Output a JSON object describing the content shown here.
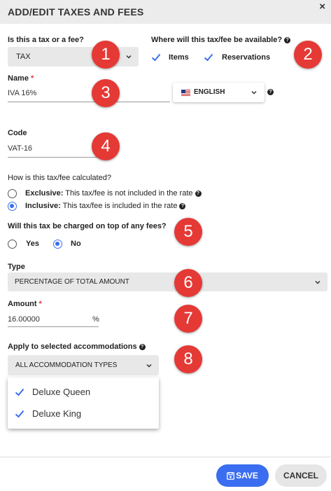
{
  "dialog": {
    "title": "ADD/EDIT TAXES AND FEES",
    "close": "×"
  },
  "tax_or_fee": {
    "label": "Is this a tax or a fee?",
    "value": "TAX"
  },
  "availability": {
    "label": "Where will this tax/fee be available?",
    "options": [
      {
        "label": "Items",
        "checked": true
      },
      {
        "label": "Reservations",
        "checked": true
      }
    ]
  },
  "name": {
    "label": "Name",
    "required": "*",
    "value": "IVA 16%"
  },
  "language": {
    "value": "ENGLISH",
    "icon": "us-flag-icon"
  },
  "code": {
    "label": "Code",
    "value": "VAT-16"
  },
  "calculation": {
    "label": "How is this tax/fee calculated?",
    "options": [
      {
        "title": "Exclusive:",
        "desc": "This tax/fee is not included in the rate",
        "selected": false
      },
      {
        "title": "Inclusive:",
        "desc": "This tax/fee is included in the rate",
        "selected": true
      }
    ]
  },
  "on_top_of_fees": {
    "label": "Will this tax be charged on top of any fees?",
    "options": [
      {
        "label": "Yes",
        "selected": false
      },
      {
        "label": "No",
        "selected": true
      }
    ]
  },
  "type": {
    "label": "Type",
    "value": "PERCENTAGE OF TOTAL AMOUNT"
  },
  "amount": {
    "label": "Amount",
    "required": "*",
    "value": "16.00000",
    "unit": "%"
  },
  "accommodations": {
    "label": "Apply to selected accommodations",
    "value": "ALL ACCOMMODATION TYPES",
    "items": [
      {
        "label": "Deluxe Queen",
        "checked": true
      },
      {
        "label": "Deluxe King",
        "checked": true
      }
    ]
  },
  "badges": [
    "1",
    "2",
    "3",
    "4",
    "5",
    "6",
    "7",
    "8"
  ],
  "footer": {
    "save": "SAVE",
    "cancel": "CANCEL"
  },
  "colors": {
    "accent": "#3a6df0",
    "badge": "#e53935",
    "field_bg": "#e8e8e8",
    "header_bg": "#ececec"
  }
}
